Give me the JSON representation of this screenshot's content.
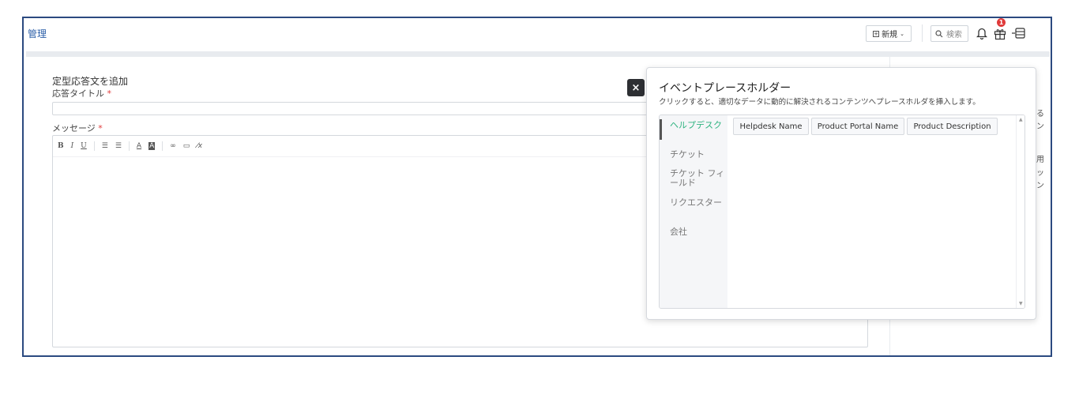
{
  "header": {
    "breadcrumb": "管理",
    "new_button_label": "新規",
    "search_placeholder": "検索",
    "notification_count": "1"
  },
  "form": {
    "title": "定型応答文を追加",
    "response_title_label": "応答タイトル",
    "message_label": "メッセージ",
    "required_mark": "*",
    "toolbar": [
      "B",
      "I",
      "U"
    ]
  },
  "popover": {
    "close_label": "×",
    "title": "イベントプレースホルダー",
    "subtitle": "クリックすると、適切なデータに動的に解決されるコンテンツへプレースホルダを挿入します。",
    "nav_items": [
      {
        "label": "ヘルプデスク",
        "active": true
      },
      {
        "label": "チケット",
        "active": false
      },
      {
        "label": "チケット フィールド",
        "active": false
      },
      {
        "label": "リクエスター",
        "active": false
      },
      {
        "label": "会社",
        "active": false
      }
    ],
    "placeholders": [
      "Helpdesk Name",
      "Product Portal Name",
      "Product Description"
    ]
  },
  "right_fragments": [
    "る",
    "ン",
    "用",
    "ッ",
    "ン"
  ]
}
